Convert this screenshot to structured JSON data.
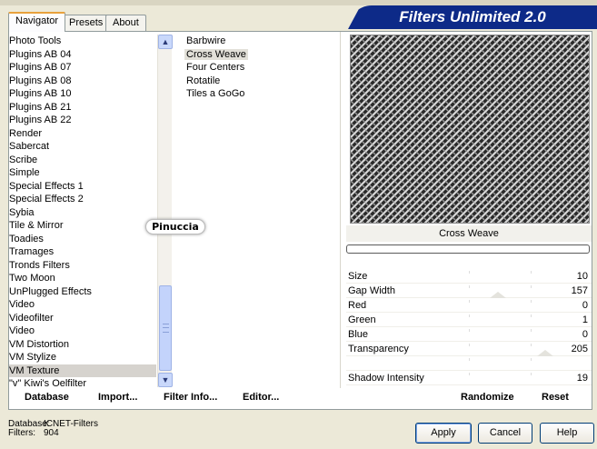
{
  "banner_title": "Filters Unlimited 2.0",
  "tabs": [
    {
      "label": "Navigator",
      "active": true
    },
    {
      "label": "Presets",
      "active": false
    },
    {
      "label": "About",
      "active": false
    }
  ],
  "categories": [
    "Photo Tools",
    "Plugins AB 04",
    "Plugins AB 07",
    "Plugins AB 08",
    "Plugins AB 10",
    "Plugins AB 21",
    "Plugins AB 22",
    "Render",
    "Sabercat",
    "Scribe",
    "Simple",
    "Special Effects 1",
    "Special Effects 2",
    "Sybia",
    "Tile & Mirror",
    "Toadies",
    "Tramages",
    "Tronds Filters",
    "Two Moon",
    "UnPlugged Effects",
    "Video",
    "Videofilter",
    "Video",
    "VM Distortion",
    "VM Stylize",
    "VM Texture",
    "\"v\" Kiwi's Oelfilter"
  ],
  "selected_category": "VM Texture",
  "filters": [
    "Barbwire",
    "Cross Weave",
    "Four Centers",
    "Rotatile",
    "Tiles a GoGo"
  ],
  "selected_filter": "Cross Weave",
  "preview": {
    "filter_name": "Cross Weave"
  },
  "params": [
    {
      "label": "Size",
      "value": "10"
    },
    {
      "label": "Gap Width",
      "value": "157"
    },
    {
      "label": "Red",
      "value": "0"
    },
    {
      "label": "Green",
      "value": "1"
    },
    {
      "label": "Blue",
      "value": "0"
    },
    {
      "label": "Transparency",
      "value": "205"
    },
    {
      "label": "",
      "value": ""
    },
    {
      "label": "Shadow Intensity",
      "value": "19"
    }
  ],
  "param_marks": [
    {
      "param": "Gap Width",
      "fraction": 0.62
    },
    {
      "param": "Transparency",
      "fraction": 0.81
    }
  ],
  "bottom_buttons": {
    "database": "Database",
    "import": "Import...",
    "filter_info": "Filter Info...",
    "editor": "Editor...",
    "randomize": "Randomize",
    "reset": "Reset"
  },
  "status": {
    "database_label": "Database:",
    "database_value": "ICNET-Filters",
    "filters_label": "Filters:",
    "filters_value": "904"
  },
  "dialog_buttons": {
    "apply": "Apply",
    "cancel": "Cancel",
    "help": "Help"
  },
  "watermark_text": "Pinuccia",
  "icons": {
    "scroll_up": "chevron-up-icon",
    "scroll_down": "chevron-down-icon"
  },
  "colors": {
    "banner": "#0d2a88",
    "tab_accent": "#e8a13c",
    "background": "#ece9d8"
  }
}
